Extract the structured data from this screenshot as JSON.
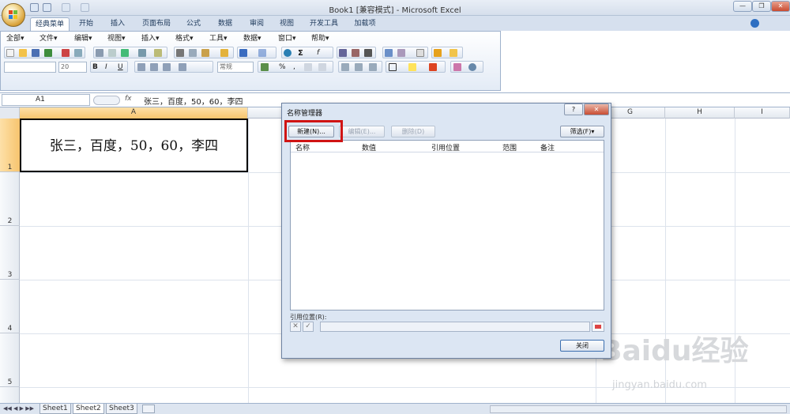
{
  "window": {
    "title": "Book1  [兼容模式] - Microsoft Excel",
    "buttons": [
      "—",
      "❐",
      "✕"
    ]
  },
  "ribbon_tabs": [
    "经典菜单",
    "开始",
    "插入",
    "页面布局",
    "公式",
    "数据",
    "审阅",
    "视图",
    "开发工具",
    "加载项"
  ],
  "menus": [
    "全部▾",
    "文件▾",
    "编辑▾",
    "视图▾",
    "插入▾",
    "格式▾",
    "工具▾",
    "数据▾",
    "窗口▾",
    "帮助▾"
  ],
  "toolbar": {
    "font_size": "20",
    "number_format": "常规"
  },
  "formula_bar": {
    "name_box": "A1",
    "fx": "fx",
    "content": "张三，百度，50，60，李四"
  },
  "columns": [
    "A",
    "G",
    "H",
    "I"
  ],
  "rows": [
    "1",
    "2",
    "3",
    "4",
    "5"
  ],
  "cell_a1": "张三，百度，50，60，李四",
  "sheets": [
    "Sheet1",
    "Sheet2",
    "Sheet3"
  ],
  "dialog": {
    "title": "名称管理器",
    "help": "?",
    "close": "✕",
    "new_button": "新建(N)...",
    "edit_button": "编辑(E)...",
    "delete_button": "删除(D)",
    "filter_button": "筛选(F)▾",
    "columns": [
      "名称",
      "数值",
      "引用位置",
      "范围",
      "备注"
    ],
    "refers_to_label": "引用位置(R):",
    "cancel_icon": "✕",
    "confirm_icon": "✓",
    "close_button": "关闭"
  },
  "watermark": {
    "text": "Baidu经验",
    "url": "jingyan.baidu.com"
  }
}
